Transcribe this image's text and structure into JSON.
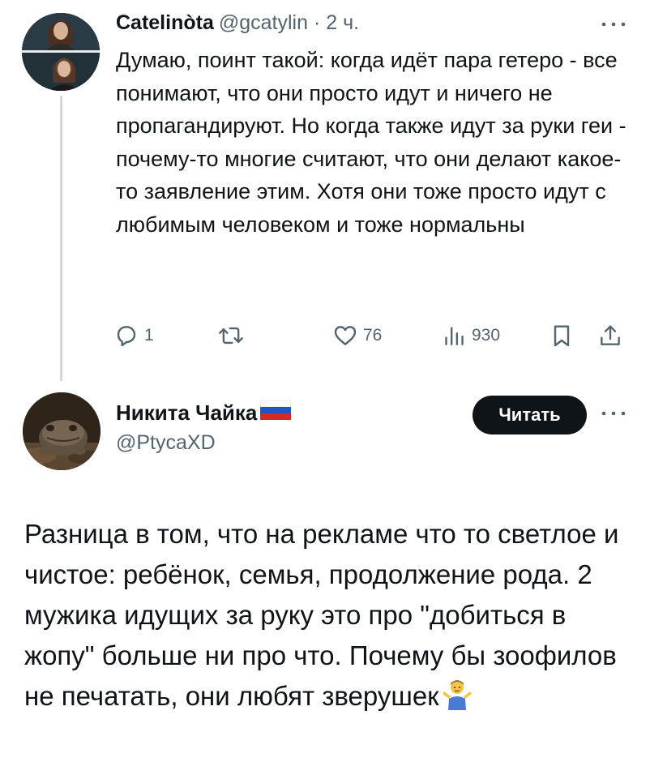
{
  "tweet1": {
    "author_name": "Catelinòta",
    "handle_meta": "@gcatylin · 2 ч.",
    "text": "Думаю, поинт такой: когда идёт пара гетеро - все понимают, что они просто идут и ничего не пропагандируют. Но когда также идут за руки геи - почему-то многие считают, что они делают какое-то заявление этим. Хотя они тоже просто идут с любимым человеком и тоже нормальны",
    "replies": "1",
    "retweets": "",
    "likes": "76",
    "views": "930",
    "icons": {
      "more": "more-horizontal-icon",
      "reply": "reply-icon",
      "retweet": "retweet-icon",
      "like": "heart-icon",
      "views": "analytics-icon",
      "bookmark": "bookmark-icon",
      "share": "share-icon"
    }
  },
  "tweet2": {
    "author_name": "Никита Чайка",
    "flag_icon": "russia-flag-icon",
    "handle": "@PtycaXD",
    "follow_label": "Читать",
    "text": "Разница в том, что на рекламе что то светлое и чистое: ребёнок, семья, продолжение рода. 2 мужика идущих за руку это про \"добиться в жопу\" больше ни про что. Почему бы зоофилов не печатать, они любят зверушек",
    "end_emoji_icon": "man-shrugging-emoji-icon"
  },
  "colors": {
    "text_primary": "#0f1419",
    "text_secondary": "#536471",
    "thread_line": "#cfd9de",
    "button_bg": "#0f1419",
    "button_text": "#ffffff"
  }
}
